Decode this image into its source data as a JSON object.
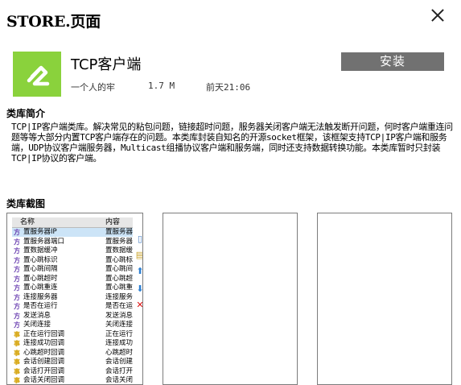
{
  "window": {
    "title": "STORE.页面"
  },
  "app": {
    "name": "TCP客户端",
    "install_label": "安装",
    "author": "一个人的牢",
    "size": "1.7 M",
    "updated": "前天21:06",
    "icon_color": "#8ad23c"
  },
  "sections": {
    "intro": "类库简介",
    "screens": "类库截图"
  },
  "description": "TCP|IP客户端类库。解决常见的粘包问题，链接超时问题，服务器关闭客户端无法触发断开问题，何时客户端重连问题等等大部分内置TCP客户端存在的问题。本类库封装自知名的开源socket框架，该框架支持TCP|IP客户端和服务端，UDP协议客户端服务器，Multicast组播协议客户端和服务端，同时还支持数据转换功能。本类库暂时只封装TCP|IP协议的客户端。",
  "screenshot": {
    "headers": [
      "名称",
      "内容"
    ],
    "rows": [
      {
        "icon": "方",
        "name": "置服务器IP",
        "value": "置服务器"
      },
      {
        "icon": "方",
        "name": "置服务器端口",
        "value": "置服务器"
      },
      {
        "icon": "方",
        "name": "置数据缓冲",
        "value": "置数据缓"
      },
      {
        "icon": "方",
        "name": "置心跳标识",
        "value": "置心跳标"
      },
      {
        "icon": "方",
        "name": "置心跳间隔",
        "value": "置心跳间"
      },
      {
        "icon": "方",
        "name": "置心跳超时",
        "value": "置心跳超"
      },
      {
        "icon": "方",
        "name": "置心跳重连",
        "value": "置心跳重"
      },
      {
        "icon": "方",
        "name": "连接服务器",
        "value": "连接服务"
      },
      {
        "icon": "方",
        "name": "是否在运行",
        "value": "是否在运"
      },
      {
        "icon": "方",
        "name": "发送消息",
        "value": "发送消息"
      },
      {
        "icon": "方",
        "name": "关闭连接",
        "value": "关闭连接"
      },
      {
        "icon": "事",
        "name": "正在运行回调",
        "value": "正在运行"
      },
      {
        "icon": "事",
        "name": "连接成功回调",
        "value": "连接成功"
      },
      {
        "icon": "事",
        "name": "心跳超时回调",
        "value": "心跳超时"
      },
      {
        "icon": "事",
        "name": "会话创建回调",
        "value": "会话创建"
      },
      {
        "icon": "事",
        "name": "会话打开回调",
        "value": "会话打开"
      },
      {
        "icon": "事",
        "name": "会话关闭回调",
        "value": "会话关闭"
      }
    ]
  }
}
